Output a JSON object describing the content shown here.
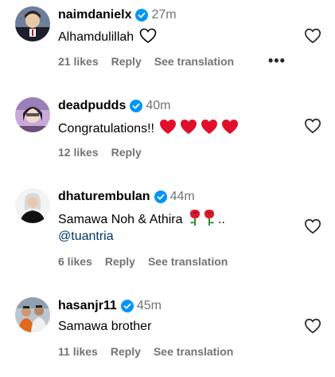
{
  "comments": [
    {
      "username": "naimdanielx",
      "time": "27m",
      "text": "Alhamdulillah",
      "likes": "21 likes",
      "reply": "Reply",
      "translation": "See translation"
    },
    {
      "username": "deadpudds",
      "time": "40m",
      "text": "Congratulations!!",
      "likes": "12 likes",
      "reply": "Reply"
    },
    {
      "username": "dhaturembulan",
      "time": "44m",
      "text": "Samawa Noh & Athira",
      "text_suffix": "..",
      "mention": "@tuantria",
      "likes": "6 likes",
      "reply": "Reply",
      "translation": "See translation"
    },
    {
      "username": "hasanjr11",
      "time": "45m",
      "text": "Samawa brother",
      "likes": "11 likes",
      "reply": "Reply",
      "translation": "See translation"
    }
  ],
  "more_options": "•••",
  "colors": {
    "verified": "#0095f6",
    "secondary_text": "#737373",
    "heart_emoji": "#e0102b",
    "mention": "#00376b"
  }
}
